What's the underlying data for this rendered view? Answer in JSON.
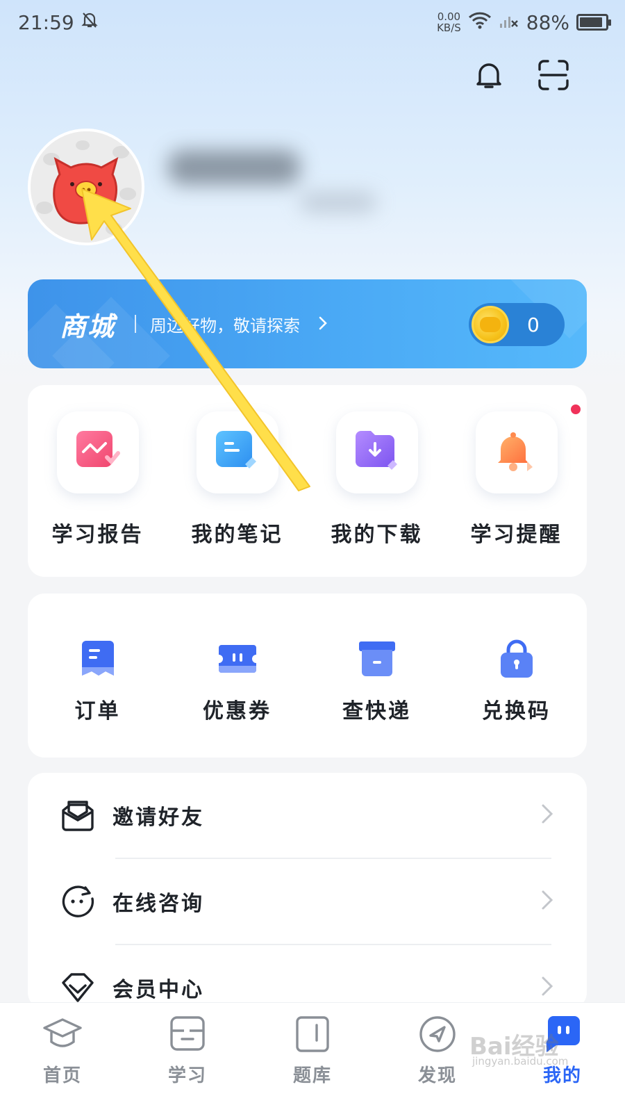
{
  "status_bar": {
    "time": "21:59",
    "net_speed_value": "0.00",
    "net_speed_unit": "KB/S",
    "battery": "88%",
    "battery_level": 0.88
  },
  "mall": {
    "title": "商城",
    "subtitle": "周边好物，敬请探索",
    "coin_count": "0"
  },
  "quick_actions": [
    {
      "label": "学习报告",
      "icon": "study-report-icon"
    },
    {
      "label": "我的笔记",
      "icon": "notes-icon"
    },
    {
      "label": "我的下载",
      "icon": "download-icon"
    },
    {
      "label": "学习提醒",
      "icon": "reminder-bell-icon",
      "has_badge": true
    }
  ],
  "services": [
    {
      "label": "订单",
      "icon": "order-icon"
    },
    {
      "label": "优惠券",
      "icon": "coupon-icon"
    },
    {
      "label": "查快递",
      "icon": "express-box-icon"
    },
    {
      "label": "兑换码",
      "icon": "redeem-lock-icon"
    }
  ],
  "menu": [
    {
      "label": "邀请好友",
      "icon": "invite-mail-icon"
    },
    {
      "label": "在线咨询",
      "icon": "chat-face-icon"
    },
    {
      "label": "会员中心",
      "icon": "vip-diamond-icon"
    }
  ],
  "bottom_nav": [
    {
      "label": "首页",
      "icon": "graduation-cap-icon",
      "active": false
    },
    {
      "label": "学习",
      "icon": "study-book-icon",
      "active": false
    },
    {
      "label": "题库",
      "icon": "question-bank-icon",
      "active": false
    },
    {
      "label": "发现",
      "icon": "discover-compass-icon",
      "active": false
    },
    {
      "label": "我的",
      "icon": "mine-chat-icon",
      "active": true
    }
  ],
  "watermark": {
    "brand": "Bai经验",
    "url": "jingyan.baidu.com"
  },
  "colors": {
    "accent": "#2b66f6",
    "mall_banner": "#4aa9f5",
    "badge": "#f0325a",
    "annotation_arrow": "#ffdf4a"
  }
}
